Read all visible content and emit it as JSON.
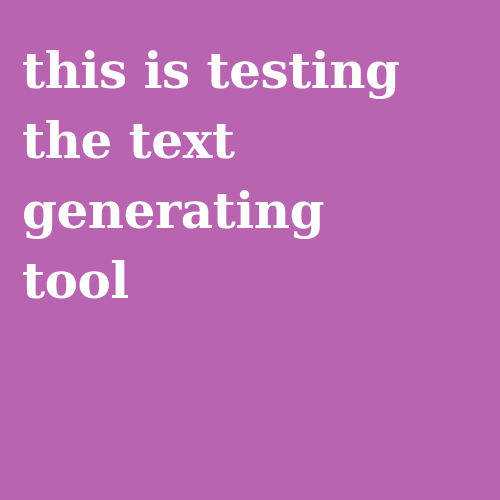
{
  "background_color": "#b864b0",
  "text_color": "#ffffff",
  "lines": [
    "this is testing",
    "the text",
    "generating",
    "tool"
  ]
}
